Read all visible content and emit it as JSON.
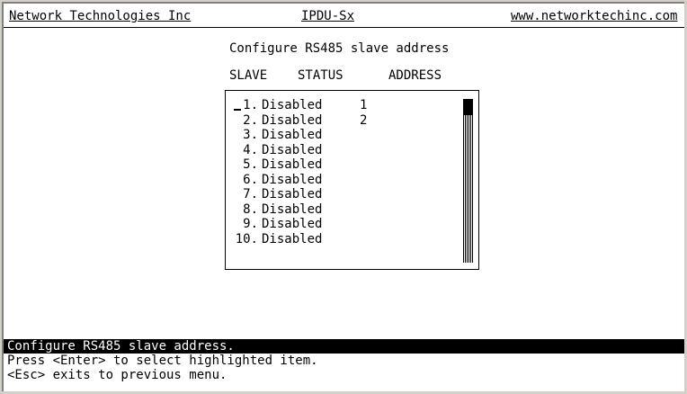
{
  "header": {
    "company": "Network Technologies Inc",
    "product": "IPDU-Sx",
    "website": "www.networktechinc.com"
  },
  "page_title": "Configure RS485 slave address",
  "columns": {
    "slave": "SLAVE",
    "status": "STATUS",
    "address": "ADDRESS"
  },
  "rows": [
    {
      "num": "1.",
      "status": "Disabled",
      "address": "1"
    },
    {
      "num": "2.",
      "status": "Disabled",
      "address": "2"
    },
    {
      "num": "3.",
      "status": "Disabled",
      "address": ""
    },
    {
      "num": "4.",
      "status": "Disabled",
      "address": ""
    },
    {
      "num": "5.",
      "status": "Disabled",
      "address": ""
    },
    {
      "num": "6.",
      "status": "Disabled",
      "address": ""
    },
    {
      "num": "7.",
      "status": "Disabled",
      "address": ""
    },
    {
      "num": "8.",
      "status": "Disabled",
      "address": ""
    },
    {
      "num": "9.",
      "status": "Disabled",
      "address": ""
    },
    {
      "num": "10.",
      "status": "Disabled",
      "address": ""
    }
  ],
  "status_line": "Configure RS485 slave address.",
  "help": {
    "line1": "Press <Enter> to select highlighted item.",
    "line2": "<Esc> exits to previous menu."
  }
}
